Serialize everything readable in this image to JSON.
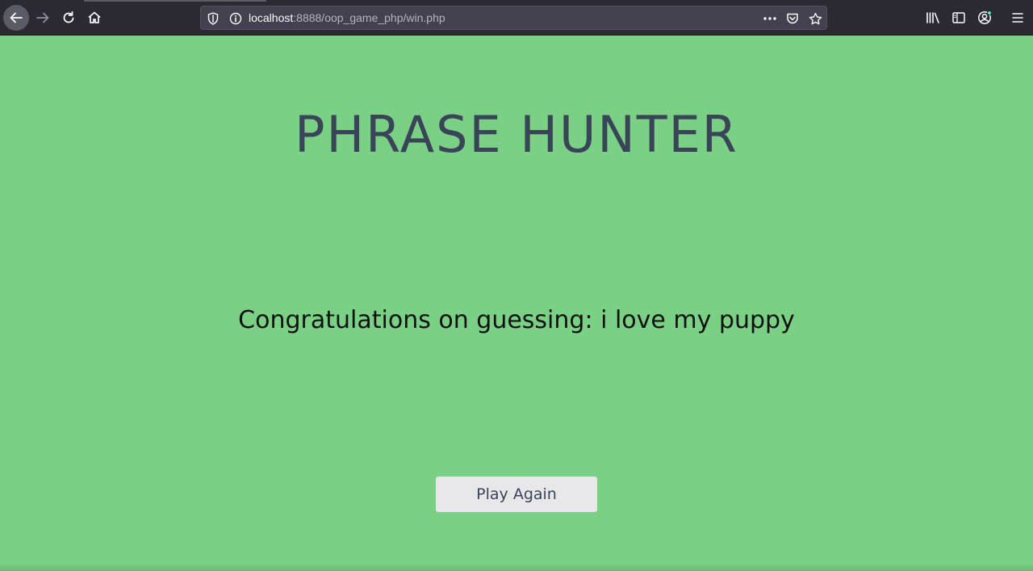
{
  "browser": {
    "url_host": "localhost",
    "url_path": ":8888/oop_game_php/win.php",
    "icons": [
      "back-icon",
      "forward-icon",
      "reload-icon",
      "home-icon",
      "shield-icon",
      "info-icon",
      "more-icon",
      "pocket-icon",
      "star-icon",
      "library-icon",
      "sidebar-icon",
      "account-icon",
      "menu-icon"
    ]
  },
  "page": {
    "title": "PHRASE HUNTER",
    "message": "Congratulations on guessing: i love my puppy",
    "button_label": "Play Again"
  },
  "colors": {
    "background": "#7ad185",
    "title": "#3a4458",
    "button": "#e8e8ea"
  }
}
